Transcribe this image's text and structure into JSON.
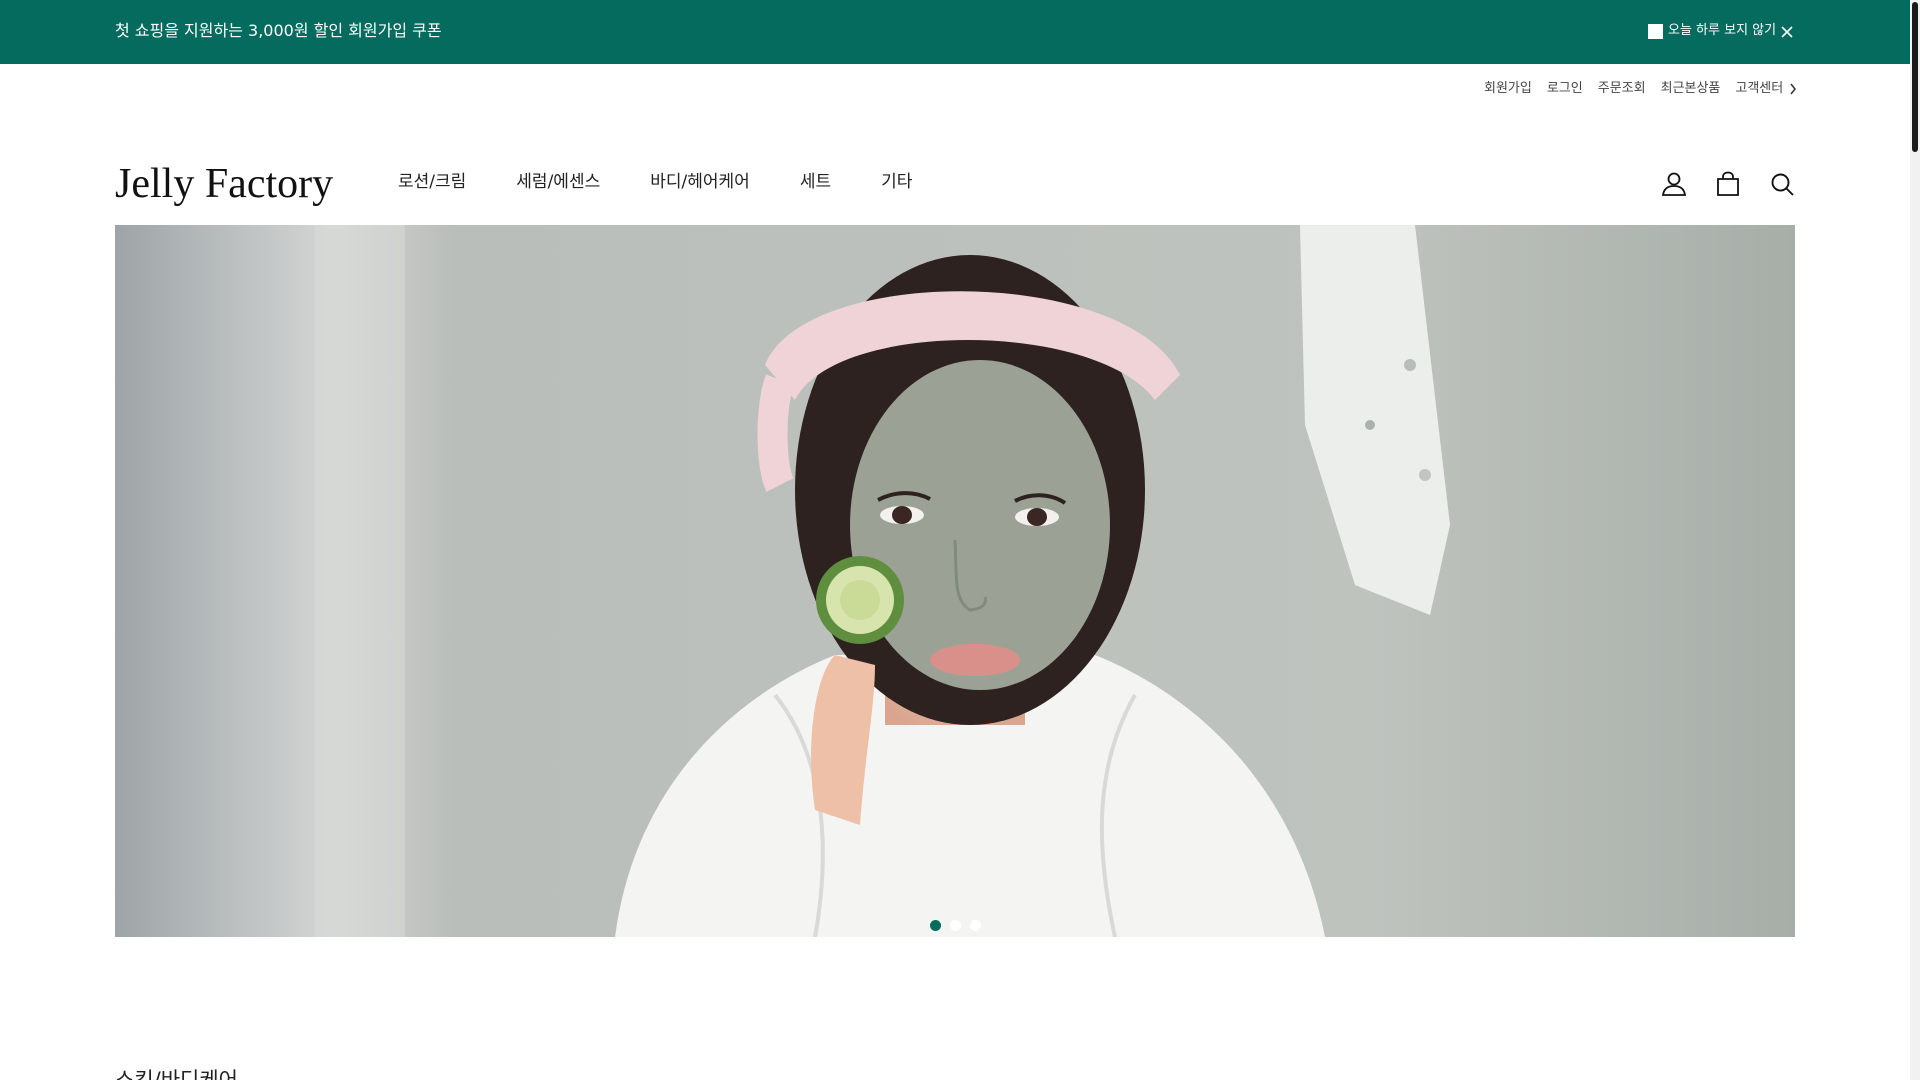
{
  "topbar": {
    "promo": "첫 쇼핑을 지원하는 3,000원 할인 회원가입 쿠폰",
    "hide_today": "오늘 하루 보지 않기",
    "bg_color": "#046b5e"
  },
  "util_nav": {
    "items": [
      "회원가입",
      "로그인",
      "주문조회",
      "최근본상품"
    ],
    "customer_center": "고객센터"
  },
  "header": {
    "logo": "Jelly Factory",
    "menu": [
      "로션/크림",
      "세럼/에센스",
      "바디/헤어케어",
      "세트",
      "기타"
    ],
    "icons": [
      "user-icon",
      "shopping-bag-icon",
      "search-icon"
    ]
  },
  "hero": {
    "slides": 3,
    "active_slide": 1
  },
  "section": {
    "title": "스킨/바디케어"
  }
}
